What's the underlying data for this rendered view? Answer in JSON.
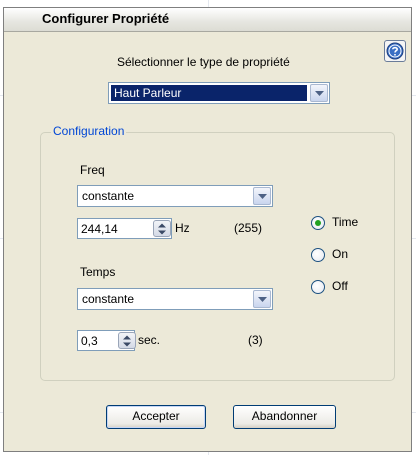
{
  "dialog": {
    "title": "Configurer Propriété",
    "help_icon": "help-question-icon"
  },
  "property_type": {
    "label": "Sélectionner le type de propriété",
    "selected": "Haut Parleur"
  },
  "configuration": {
    "group_title": "Configuration",
    "freq": {
      "label": "Freq",
      "mode": "constante",
      "value": "244,14",
      "unit": "Hz",
      "raw": "(255)"
    },
    "temps": {
      "label": "Temps",
      "mode": "constante",
      "value": "0,3",
      "unit": "sec.",
      "raw": "(3)"
    },
    "radios": [
      {
        "label": "Time",
        "checked": true
      },
      {
        "label": "On",
        "checked": false
      },
      {
        "label": "Off",
        "checked": false
      }
    ]
  },
  "buttons": {
    "accept": "Accepter",
    "cancel": "Abandonner"
  },
  "colors": {
    "accent": "#0a246a",
    "group_title": "#0046d5",
    "radio_dot": "#21a121",
    "dialog_bg": "#ece9d8"
  }
}
